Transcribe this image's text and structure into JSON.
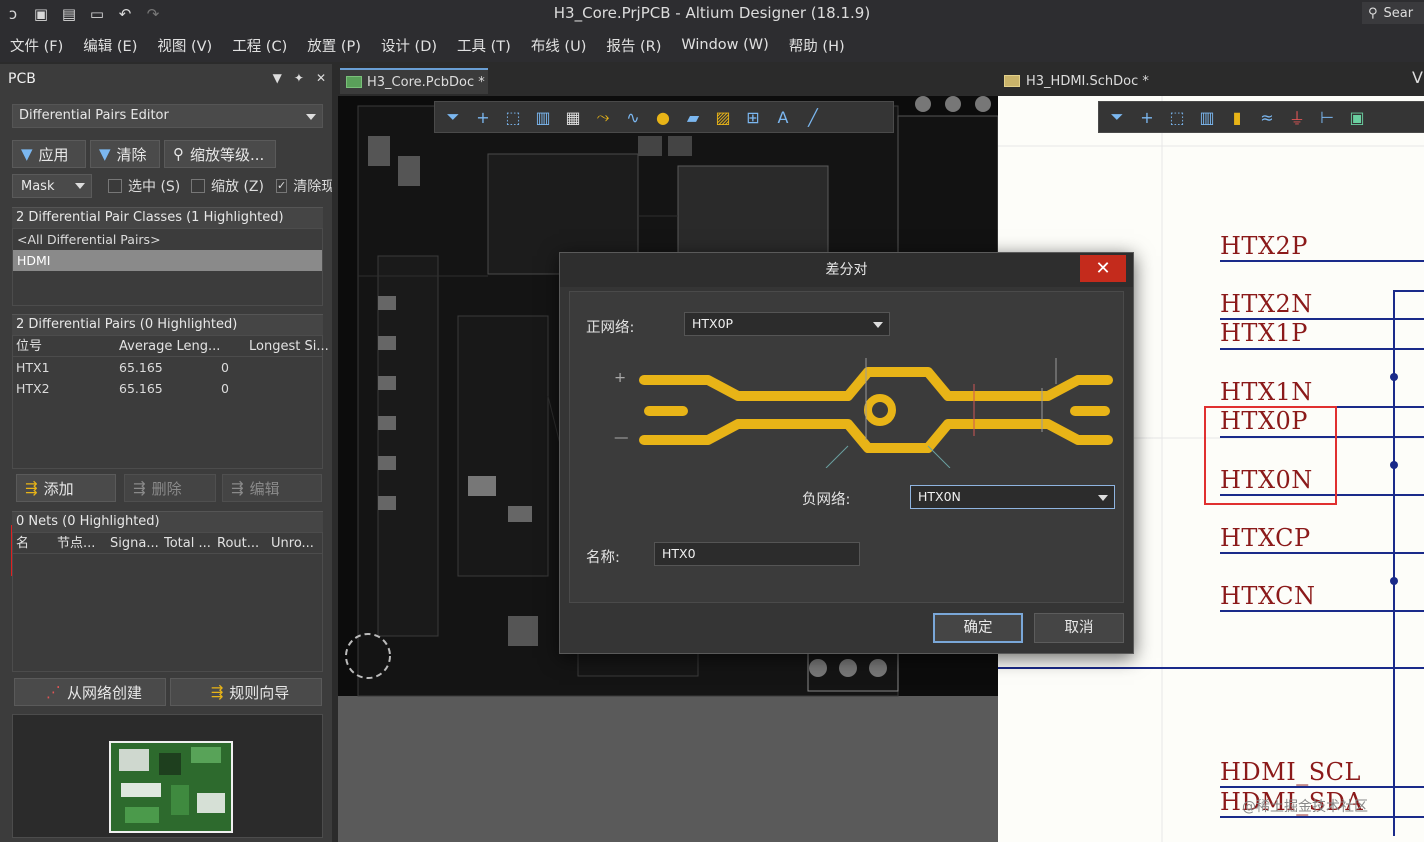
{
  "window": {
    "title": "H3_Core.PrjPCB - Altium Designer (18.1.9)",
    "search_label": "Sear"
  },
  "menu": [
    "文件 (F)",
    "编辑 (E)",
    "视图 (V)",
    "工程 (C)",
    "放置 (P)",
    "设计 (D)",
    "工具 (T)",
    "布线 (U)",
    "报告 (R)",
    "Window (W)",
    "帮助 (H)"
  ],
  "panel": {
    "title": "PCB",
    "mode": "Differential Pairs Editor",
    "apply_label": "应用",
    "clear_label": "清除",
    "zoom_label": "缩放等级...",
    "mask_label": "Mask",
    "select_label": "选中 (S)",
    "zoom_check_label": "缩放 (Z)",
    "clear_check_label": "清除现",
    "classes_header": "2 Differential Pair Classes (1 Highlighted)",
    "classes": [
      "<All Differential Pairs>",
      "HDMI"
    ],
    "pairs_header": "2 Differential Pairs (0 Highlighted)",
    "pairs_columns": [
      "位号",
      "Average Leng...",
      "Longest Si..."
    ],
    "pairs": [
      {
        "name": "HTX1",
        "avg": "65.165",
        "longest": "0"
      },
      {
        "name": "HTX2",
        "avg": "65.165",
        "longest": "0"
      }
    ],
    "add_label": "添加",
    "delete_label": "删除",
    "edit_label": "编辑",
    "nets_header": "0 Nets (0 Highlighted)",
    "nets_columns": [
      "名",
      "节点...",
      "Signa...",
      "Total ...",
      "Rout...",
      "Unro..."
    ],
    "create_from_nets_label": "从网络创建",
    "rule_wizard_label": "规则向导"
  },
  "tabs": {
    "pcb": "H3_Core.PcbDoc *",
    "sch": "H3_HDMI.SchDoc *",
    "more": "V"
  },
  "schematic": {
    "labels": [
      "HTX2P",
      "HTX2N",
      "HTX1P",
      "HTX1N",
      "HTX0P",
      "HTX0N",
      "HTXCP",
      "HTXCN",
      "HDMI_SCL",
      "HDMI_SDA"
    ],
    "watermark": "@稀土掘金技术社区"
  },
  "dialog": {
    "title": "差分对",
    "positive_net_label": "正网络:",
    "positive_net_value": "HTX0P",
    "negative_net_label": "负网络:",
    "negative_net_value": "HTX0N",
    "name_label": "名称:",
    "name_value": "HTX0",
    "plus": "+",
    "minus": "—",
    "ok_label": "确定",
    "cancel_label": "取消",
    "close_symbol": "✕",
    "trace_color": "#e8b417"
  },
  "colors": {
    "accent_tab": "#6a9fd4",
    "highlight_box": "#e02020",
    "sch_label": "#8b1a1a",
    "sch_wire": "#1a2a8a"
  }
}
